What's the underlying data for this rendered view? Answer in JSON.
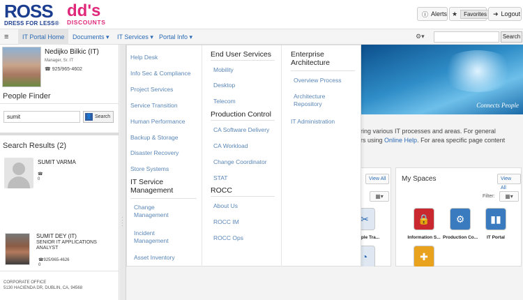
{
  "header": {
    "ross_logo": "ROSS",
    "ross_tagline": "DRESS FOR LESS®",
    "dds_logo": "dd's",
    "dds_tagline": "DISCOUNTS",
    "alerts_label": "Alerts",
    "favorites_label": "Favorites",
    "logout_label": "Logout"
  },
  "nav": {
    "tabs": [
      "IT Portal Home",
      "Documents ▾",
      "IT Services ▾",
      "Portal Info ▾"
    ],
    "gear": "⚙▾",
    "search_placeholder": "",
    "search_button": "Search"
  },
  "profile": {
    "name": "Nedijko Bilkic (IT)",
    "title": "Manager, Sr. IT",
    "phone": "925/965-4602"
  },
  "people_finder": {
    "title": "People Finder",
    "input_value": "sumit",
    "button": "Search"
  },
  "search_results": {
    "title": "Search Results (2)",
    "results": [
      {
        "name": "SUMIT VARMA",
        "phone": "0"
      },
      {
        "name": "SUMIT DEY (IT)",
        "title_line1": "SENIOR IT APPLICATIONS",
        "title_line2": "ANALYST",
        "phone": "925/965-4626",
        "ext": "0"
      }
    ],
    "corp_label": "CORPORATE OFFICE",
    "corp_address": "5130 HACIENDA DR, DUBLIN, CA, 94568"
  },
  "mega_menu": {
    "col1_items": [
      "Help Desk",
      "Info Sec & Compliance",
      "Project Services",
      "Service Transition",
      "Human Performance",
      "Backup & Storage",
      "Disaster Recovery",
      "Store Systems"
    ],
    "col1_heading": "IT Service Management",
    "col1_heading_line1": "IT Service",
    "col1_heading_line2": "Management",
    "col1_sub": [
      "Change Management",
      "Incident Management",
      "Asset Inventory"
    ],
    "col1_sub_split": [
      [
        "Change",
        "Management"
      ],
      [
        "Incident",
        "Management"
      ],
      [
        "Asset Inventory"
      ]
    ],
    "col2_heading": "End User Services",
    "col2_items": [
      "Mobility",
      "Desktop",
      "Telecom"
    ],
    "col2_heading2": "Production Control",
    "col2_items2": [
      "CA Software Delivery",
      "CA Workload",
      "Change Coordinator",
      "STAT"
    ],
    "col2_heading3": "ROCC",
    "col2_items3": [
      "About Us",
      "ROCC IM",
      "ROCC Ops"
    ],
    "col3_heading_line1": "Enterprise",
    "col3_heading_line2": "Architecture",
    "col3_items": [
      "Overview Process"
    ],
    "col3_item2_line1": "Architecture",
    "col3_item2_line2": "Repository",
    "col3_item3": "IT Administration"
  },
  "main": {
    "hero_caption": "Connects People",
    "text_line1": "ering various IT processes and areas. For general",
    "text_line2_pre": "ers using ",
    "text_line2_link": "Online Help",
    "text_line2_post": ".  For area specific page content",
    "left_panel": {
      "view_all": "View All",
      "tiles": [
        "ple Tra..."
      ]
    },
    "my_spaces": {
      "title": "My Spaces",
      "view_all": "View All",
      "filter_label": "Filter:",
      "tiles": [
        "Information S...",
        "Production Co...",
        "IT Portal"
      ]
    }
  },
  "colors": {
    "brand_blue": "#1a3d8f",
    "brand_pink": "#e0287b",
    "link": "#2a6ab4",
    "menu_link": "#5a86b6"
  }
}
